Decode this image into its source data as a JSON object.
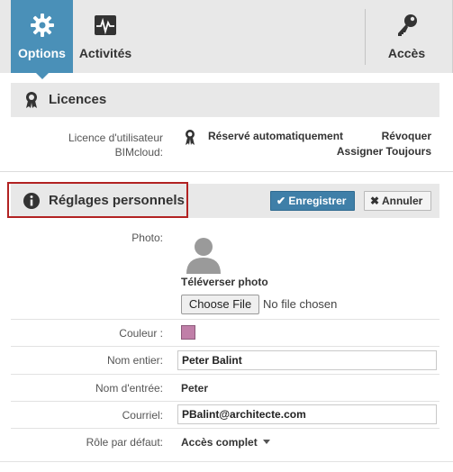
{
  "toolbar": {
    "tabs": [
      {
        "label": "Options",
        "icon": "gear-icon",
        "active": true
      },
      {
        "label": "Activités",
        "icon": "activity-monitor-icon",
        "active": false
      },
      {
        "label": "Accès",
        "icon": "key-icon",
        "active": false
      }
    ]
  },
  "licences": {
    "title": "Licences",
    "icon": "award-ribbon-icon",
    "label_line1": "Licence d'utilisateur",
    "label_line2": "BIMcloud:",
    "value": "Réservé automatiquement",
    "revoke": "Révoquer",
    "assign": "Assigner Toujours"
  },
  "settings": {
    "title": "Réglages personnels",
    "icon": "info-icon",
    "save_label": "Enregistrer",
    "cancel_label": "Annuler",
    "highlight_color": "#b22222"
  },
  "form": {
    "photo_label": "Photo:",
    "upload_title": "Téléverser photo",
    "file_button": "Choose File",
    "file_status": "No file chosen",
    "color_label": "Couleur :",
    "color_value": "#c07fa8",
    "fullname_label": "Nom entier:",
    "fullname_value": "Peter Balint",
    "login_label": "Nom d'entrée:",
    "login_value": "Peter",
    "email_label": "Courriel:",
    "email_value": "PBalint@architecte.com",
    "role_label": "Rôle par défaut:",
    "role_value": "Accès complet"
  },
  "colors": {
    "accent": "#4a90b8",
    "save_button": "#3f7fa8",
    "header_bg": "#e8e8e8"
  }
}
